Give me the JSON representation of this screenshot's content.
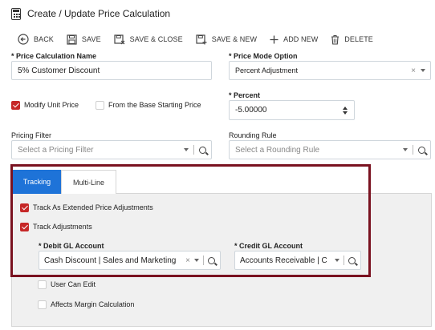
{
  "window": {
    "title": "Create / Update Price Calculation"
  },
  "toolbar": {
    "back": "BACK",
    "save": "SAVE",
    "save_close": "SAVE & CLOSE",
    "save_new": "SAVE & NEW",
    "add_new": "ADD NEW",
    "delete": "DELETE"
  },
  "form": {
    "name_label": "* Price Calculation Name",
    "name_value": "5% Customer Discount",
    "mode_label": "* Price Mode Option",
    "mode_value": "Percent Adjustment",
    "modify_unit_price_label": "Modify Unit Price",
    "modify_unit_price_checked": true,
    "base_starting_label": "From the Base Starting Price",
    "base_starting_checked": false,
    "percent_label": "* Percent",
    "percent_value": "-5.00000",
    "pricing_filter_label": "Pricing Filter",
    "pricing_filter_placeholder": "Select a Pricing Filter",
    "rounding_rule_label": "Rounding Rule",
    "rounding_rule_placeholder": "Select a Rounding Rule"
  },
  "tabs": [
    {
      "label": "Tracking",
      "active": true
    },
    {
      "label": "Multi-Line",
      "active": false
    }
  ],
  "tracking": {
    "track_extended_label": "Track As Extended Price Adjustments",
    "track_extended_checked": true,
    "track_adjustments_label": "Track Adjustments",
    "track_adjustments_checked": true,
    "debit_label": "* Debit GL Account",
    "debit_value": "Cash Discount | Sales and Marketing",
    "credit_label": "* Credit GL Account",
    "credit_value": "Accounts Receivable | C",
    "user_can_edit_label": "User Can Edit",
    "user_can_edit_checked": false,
    "affects_margin_label": "Affects Margin Calculation",
    "affects_margin_checked": false
  },
  "colors": {
    "accent": "#1e73d8",
    "check": "#c62828",
    "highlight": "#7a1220"
  }
}
